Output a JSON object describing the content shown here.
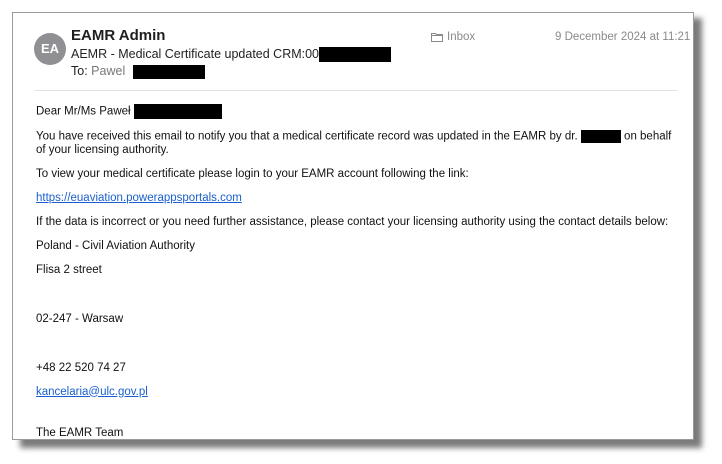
{
  "message": {
    "avatar_initials": "EA",
    "sender": "EAMR Admin",
    "subject": "AEMR - Medical Certificate updated CRM:00",
    "to_label": "To:",
    "to_name": "Pawel",
    "mailbox": "Inbox",
    "date": "9 December 2024 at 11:21"
  },
  "body": {
    "greeting": "Dear Mr/Ms Paweł",
    "line1_before": "You have received this email to notify you that a medical certificate record was updated in the EAMR by dr.",
    "line1_after": "on behalf of your licensing authority.",
    "line2": "To view your medical certificate please login to your EAMR account following the link:",
    "link": "https://euaviation.powerappsportals.com",
    "line3": "If the data is incorrect or you need further assistance, please contact your licensing authority using the contact details below:",
    "authority": "Poland - Civil Aviation Authority",
    "street": "Flisa 2 street",
    "postal": "02-247 - Warsaw",
    "phone": "+48 22 520 74 27",
    "email": "kancelaria@ulc.gov.pl",
    "signature": "The EAMR Team"
  },
  "icons": {
    "mailbox_icon": "folder-icon"
  },
  "colors": {
    "link": "#1a5fcf",
    "avatar_bg": "#8f8f94",
    "meta_text": "#8a8a8a"
  }
}
